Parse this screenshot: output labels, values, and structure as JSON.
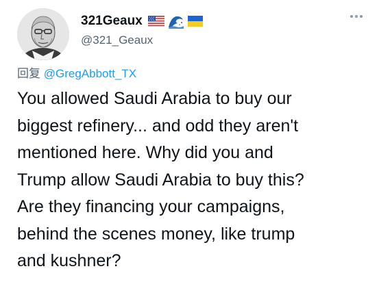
{
  "author": {
    "display_name": "321Geaux",
    "handle": "@321_Geaux",
    "badges": [
      "us-flag-icon",
      "water-wave-icon",
      "ukraine-flag-icon"
    ]
  },
  "reply": {
    "prefix": "回复 ",
    "mention": "@GregAbbott_TX"
  },
  "tweet": {
    "lines": [
      "You allowed Saudi Arabia to buy our",
      "biggest refinery... and odd they aren't",
      "mentioned here.  Why did you and",
      "Trump allow Saudi Arabia to buy this?",
      "Are they financing your campaigns,",
      "behind the scenes money, like trump",
      "and kushner?"
    ]
  },
  "colors": {
    "text": "#0f1419",
    "secondary": "#536471",
    "link": "#1d9bf0"
  }
}
